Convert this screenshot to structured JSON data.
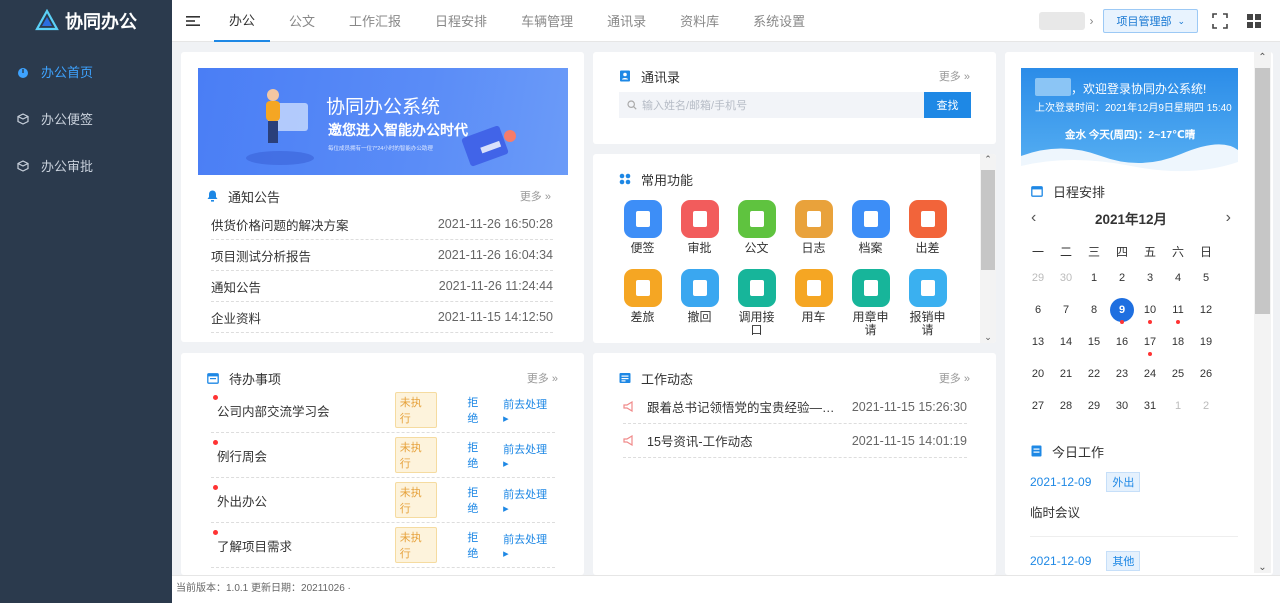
{
  "brand": {
    "name": "协同办公"
  },
  "sidebar": {
    "items": [
      {
        "label": "办公首页",
        "active": true
      },
      {
        "label": "办公便签"
      },
      {
        "label": "办公审批"
      }
    ]
  },
  "topnav": {
    "tabs": [
      "办公",
      "公文",
      "工作汇报",
      "日程安排",
      "车辆管理",
      "通讯录",
      "资料库",
      "系统设置"
    ],
    "active": "办公",
    "department": "项目管理部"
  },
  "banner": {
    "title": "协同办公系统",
    "subtitle": "邀您进入智能办公时代",
    "caption": "每位成员拥有一位7*24小时的智能办公助理"
  },
  "notice": {
    "title": "通知公告",
    "more": "更多",
    "rows": [
      {
        "title": "供货价格问题的解决方案",
        "date": "2021-11-26 16:50:28"
      },
      {
        "title": "项目测试分析报告",
        "date": "2021-11-26 16:04:34"
      },
      {
        "title": "通知公告",
        "date": "2021-11-26 11:24:44"
      },
      {
        "title": "企业资料",
        "date": "2021-11-15 14:12:50"
      }
    ]
  },
  "todo": {
    "title": "待办事项",
    "more": "更多",
    "status": "未执行",
    "reject": "拒绝",
    "go": "前去处理",
    "rows": [
      "公司内部交流学习会",
      "例行周会",
      "外出办公",
      "了解项目需求"
    ]
  },
  "contacts": {
    "title": "通讯录",
    "more": "更多",
    "placeholder": "输入姓名/邮箱/手机号",
    "search": "查找"
  },
  "functions": {
    "title": "常用功能",
    "items": [
      {
        "label": "便签",
        "color": "#3d8ef7"
      },
      {
        "label": "审批",
        "color": "#f25c5c"
      },
      {
        "label": "公文",
        "color": "#5fc33f"
      },
      {
        "label": "日志",
        "color": "#e9a23b"
      },
      {
        "label": "档案",
        "color": "#3d8ef7"
      },
      {
        "label": "出差",
        "color": "#f2643a"
      },
      {
        "label": "差旅",
        "color": "#f5a623"
      },
      {
        "label": "撤回",
        "color": "#3aa7f0"
      },
      {
        "label": "调用接口",
        "color": "#17b59a"
      },
      {
        "label": "用车",
        "color": "#f5a623"
      },
      {
        "label": "用章申请",
        "color": "#17b59a"
      },
      {
        "label": "报销申请",
        "color": "#3ab0f0"
      }
    ]
  },
  "news": {
    "title": "工作动态",
    "more": "更多",
    "rows": [
      {
        "title": "跟着总书记领悟党的宝贵经验——坚持...",
        "date": "2021-11-15 15:26:30"
      },
      {
        "title": "15号资讯-工作动态",
        "date": "2021-11-15 14:01:19"
      }
    ]
  },
  "welcome": {
    "line1": "，欢迎登录协同办公系统!",
    "line2": "上次登录时间：2021年12月9日星期四 15:40",
    "line3": "金水  今天(周四)：2~17℃晴"
  },
  "schedule": {
    "title": "日程安排",
    "month": "2021年12月",
    "weekdays": [
      "一",
      "二",
      "三",
      "四",
      "五",
      "六",
      "日"
    ],
    "days": [
      [
        "29",
        "o"
      ],
      [
        "30",
        "o"
      ],
      [
        "1",
        ""
      ],
      [
        "2",
        ""
      ],
      [
        "3",
        ""
      ],
      [
        "4",
        ""
      ],
      [
        "5",
        ""
      ],
      [
        "6",
        ""
      ],
      [
        "7",
        ""
      ],
      [
        "8",
        ""
      ],
      [
        "9",
        "today"
      ],
      [
        "10",
        "ev"
      ],
      [
        "11",
        "ev"
      ],
      [
        "12",
        ""
      ],
      [
        "13",
        ""
      ],
      [
        "14",
        ""
      ],
      [
        "15",
        ""
      ],
      [
        "16",
        ""
      ],
      [
        "17",
        "ev"
      ],
      [
        "18",
        ""
      ],
      [
        "19",
        ""
      ],
      [
        "20",
        ""
      ],
      [
        "21",
        ""
      ],
      [
        "22",
        ""
      ],
      [
        "23",
        ""
      ],
      [
        "24",
        ""
      ],
      [
        "25",
        ""
      ],
      [
        "26",
        ""
      ],
      [
        "27",
        ""
      ],
      [
        "28",
        ""
      ],
      [
        "29",
        ""
      ],
      [
        "30",
        ""
      ],
      [
        "31",
        ""
      ],
      [
        "1",
        "o"
      ],
      [
        "2",
        "o"
      ]
    ]
  },
  "today": {
    "title": "今日工作",
    "items": [
      {
        "date": "2021-12-09",
        "tag": "外出",
        "text": "临时会议"
      },
      {
        "date": "2021-12-09",
        "tag": "其他",
        "text": ""
      }
    ]
  },
  "footer": {
    "text": "当前版本：1.0.1 更新日期：20211026"
  }
}
